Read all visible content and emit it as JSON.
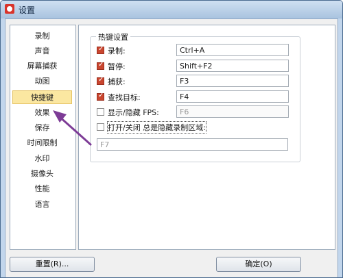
{
  "window": {
    "title": "设置"
  },
  "sidebar": {
    "items": [
      {
        "label": "录制"
      },
      {
        "label": "声音"
      },
      {
        "label": "屏幕捕获"
      },
      {
        "label": "动图"
      },
      {
        "label": "快捷键",
        "selected": true
      },
      {
        "label": "效果"
      },
      {
        "label": "保存"
      },
      {
        "label": "时间限制"
      },
      {
        "label": "水印"
      },
      {
        "label": "摄像头"
      },
      {
        "label": "性能"
      },
      {
        "label": "语言"
      }
    ]
  },
  "hotkeys": {
    "group_title": "热键设置",
    "rows": [
      {
        "label": "录制:",
        "checked": true,
        "value": "Ctrl+A"
      },
      {
        "label": "暂停:",
        "checked": true,
        "value": "Shift+F2"
      },
      {
        "label": "捕获:",
        "checked": true,
        "value": "F3"
      },
      {
        "label": "查找目标:",
        "checked": true,
        "value": "F4"
      },
      {
        "label": "显示/隐藏 FPS:",
        "checked": false,
        "value": "F6"
      }
    ],
    "toggle_area": {
      "label": "打开/关闭 总是隐藏录制区域:",
      "checked": false,
      "value": "F7"
    }
  },
  "buttons": {
    "reset": "重置(R)...",
    "ok": "确定(O)"
  },
  "colors": {
    "accent_check": "#c9462f",
    "selected_item": "#fbe7a1",
    "arrow": "#7d3c96"
  }
}
